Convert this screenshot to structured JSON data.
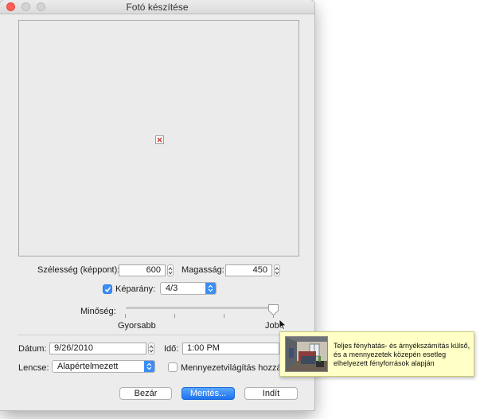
{
  "window": {
    "title": "Fotó készítése"
  },
  "size": {
    "width_label": "Szélesség (képpont):",
    "width_value": "600",
    "height_label": "Magasság:",
    "height_value": "450"
  },
  "aspect": {
    "label": "Képarány:",
    "checked": true,
    "value": "4/3"
  },
  "quality": {
    "label": "Minőség:",
    "min_label": "Gyorsabb",
    "max_label": "Jobb",
    "level": 1.0
  },
  "date": {
    "label": "Dátum:",
    "value": "9/26/2010"
  },
  "time": {
    "label": "Idő:",
    "value": "1:00 PM"
  },
  "lens": {
    "label": "Lencse:",
    "value": "Alapértelmezett"
  },
  "ceiling_light": {
    "label": "Mennyezetvilágítás hozzáa",
    "checked": false
  },
  "buttons": {
    "close": "Bezár",
    "save": "Mentés...",
    "start": "Indít"
  },
  "tooltip": {
    "lines": [
      "Teljes fényhatás- és árnyékszámítás külső,",
      "és a mennyezetek közepén esetleg",
      "elhelyezett fényforrások alapján"
    ]
  },
  "colors": {
    "accent": "#3b8df7",
    "close_light": "#fc5f57",
    "tooltip_bg": "#ffffc6"
  }
}
